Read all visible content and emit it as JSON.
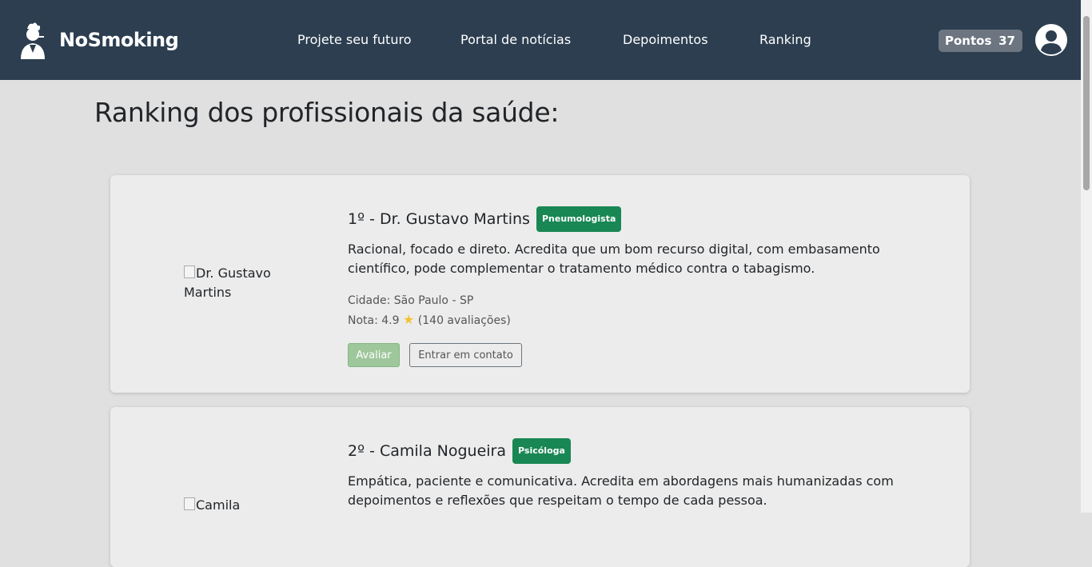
{
  "brand": {
    "name": "NoSmoking",
    "logo_icon": "smoker-character-icon"
  },
  "nav": {
    "links": [
      "Projete seu futuro",
      "Portal de notícias",
      "Depoimentos",
      "Ranking"
    ]
  },
  "points": {
    "label": "Pontos",
    "value": "37"
  },
  "user": {
    "icon": "user-avatar-icon"
  },
  "page": {
    "title": "Ranking dos profissionais da saúde:"
  },
  "professionals": [
    {
      "rank_title": "1º - Dr. Gustavo Martins",
      "specialty": "Pneumologista",
      "photo_alt": "Dr. Gustavo Martins",
      "description": "Racional, focado e direto. Acredita que um bom recurso digital, com embasamento científico, pode complementar o tratamento médico contra o tabagismo.",
      "city": "Cidade: São Paulo - SP",
      "rating_label": "Nota: 4.9",
      "reviews": "(140 avaliações)",
      "rate_button": "Avaliar",
      "contact_button": "Entrar em contato"
    },
    {
      "rank_title": "2º - Camila Nogueira",
      "specialty": "Psicóloga",
      "photo_alt": "Camila",
      "description": "Empática, paciente e comunicativa. Acredita em abordagens mais humanizadas com depoimentos e reflexões que respeitam o tempo de cada pessoa."
    }
  ],
  "colors": {
    "navbar": "#2c3e50",
    "badge": "#198754",
    "background": "#e0e0e0",
    "card": "#ececec"
  }
}
